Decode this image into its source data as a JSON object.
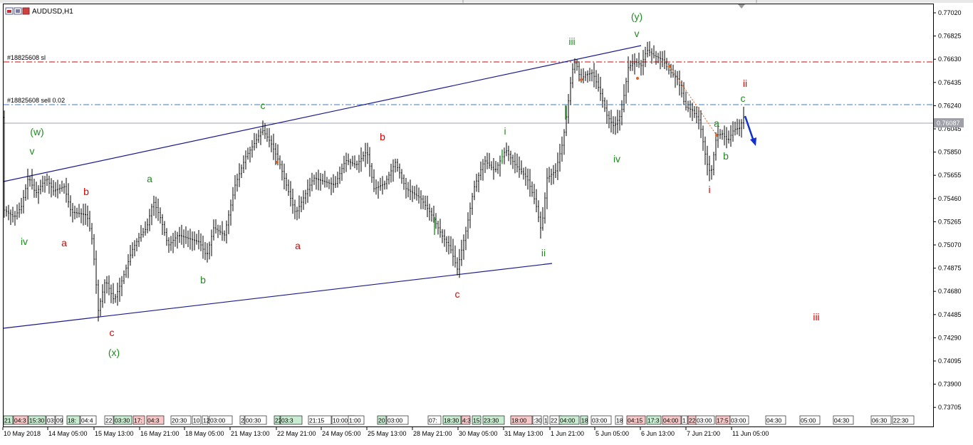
{
  "window": {
    "symbol_title": "AUDUSD,H1"
  },
  "orders": {
    "sl_label": "#18825608 sl",
    "sell_label": "#18825608 sell 0.02"
  },
  "price_axis": {
    "ticks": [
      "0.77020",
      "0.76825",
      "0.76630",
      "0.76435",
      "0.76240",
      "0.76045",
      "0.75850",
      "0.75655",
      "0.75460",
      "0.75265",
      "0.75070",
      "0.74875",
      "0.74680",
      "0.74485",
      "0.74290",
      "0.74095",
      "0.73900",
      "0.73705"
    ],
    "current_price": "0.76087"
  },
  "time_axis": {
    "labels": [
      "10 May 2018",
      "14 May 05:00",
      "15 May 13:00",
      "16 May 21:00",
      "18 May 05:00",
      "21 May 13:00",
      "22 May 21:00",
      "24 May 05:00",
      "25 May 13:00",
      "28 May 21:00",
      "30 May 05:00",
      "31 May 13:00",
      "1 Jun 21:00",
      "5 Jun 05:00",
      "6 Jun 13:00",
      "7 Jun 21:00",
      "11 Jun 05:00"
    ]
  },
  "session_strip": [
    {
      "t": "21",
      "c": "#c8ecd0"
    },
    {
      "t": "04:3",
      "c": "#f8c8c8"
    },
    {
      "t": "15:30",
      "c": "#c8ecd0"
    },
    {
      "t": "03:0",
      "c": "#ffffff"
    },
    {
      "t": "09",
      "c": "#ffffff"
    },
    {
      "t": "18:",
      "c": "#c8ecd0"
    },
    {
      "t": "04:4",
      "c": "#ffffff"
    },
    {
      "t": "22",
      "c": "#ffffff"
    },
    {
      "t": "03:30",
      "c": "#c8ecd0"
    },
    {
      "t": "17:",
      "c": "#f8c8c8"
    },
    {
      "t": "04:3",
      "c": "#f8c8c8"
    },
    {
      "t": "20:30",
      "c": "#ffffff"
    },
    {
      "t": "10",
      "c": "#ffffff"
    },
    {
      "t": "12",
      "c": "#ffffff"
    },
    {
      "t": "03:00",
      "c": "#ffffff"
    },
    {
      "t": "2",
      "c": "#ffffff"
    },
    {
      "t": "00:30",
      "c": "#ffffff"
    },
    {
      "t": "22",
      "c": "#c8ecd0"
    },
    {
      "t": "03:3",
      "c": "#c8ecd0"
    },
    {
      "t": "21:15",
      "c": "#ffffff"
    },
    {
      "t": "10:00",
      "c": "#ffffff"
    },
    {
      "t": "1:00",
      "c": "#ffffff"
    },
    {
      "t": "20",
      "c": "#c8ecd0"
    },
    {
      "t": "03:00",
      "c": "#ffffff"
    },
    {
      "t": "07:",
      "c": "#ffffff"
    },
    {
      "t": "18:30",
      "c": "#c8ecd0"
    },
    {
      "t": "4:3",
      "c": "#f8c8c8"
    },
    {
      "t": "15:",
      "c": "#c8ecd0"
    },
    {
      "t": "23:30",
      "c": "#c8ecd0"
    },
    {
      "t": "18:00",
      "c": "#f8c8c8"
    },
    {
      "t": ":30",
      "c": "#ffffff"
    },
    {
      "t": "1",
      "c": "#ffffff"
    },
    {
      "t": "22",
      "c": "#ffffff"
    },
    {
      "t": "04:00",
      "c": "#c8ecd0"
    },
    {
      "t": "18",
      "c": "#c8ecd0"
    },
    {
      "t": "03:00",
      "c": "#ffffff"
    },
    {
      "t": "18",
      "c": "#ffffff"
    },
    {
      "t": "04:15",
      "c": "#f8c8c8"
    },
    {
      "t": "17:3",
      "c": "#c8ecd0"
    },
    {
      "t": "04:00",
      "c": "#f8c8c8"
    },
    {
      "t": "1",
      "c": "#ffffff"
    },
    {
      "t": "22",
      "c": "#f8c8c8"
    },
    {
      "t": "03:00",
      "c": "#ffffff"
    },
    {
      "t": "17:5",
      "c": "#f8c8c8"
    },
    {
      "t": "03:00",
      "c": "#ffffff"
    },
    {
      "t": "04:30",
      "c": "#ffffff"
    },
    {
      "t": "05:00",
      "c": "#ffffff"
    },
    {
      "t": "04:30",
      "c": "#ffffff"
    },
    {
      "t": "06:30",
      "c": "#ffffff"
    },
    {
      "t": "22:30",
      "c": "#ffffff"
    }
  ],
  "wave_labels": [
    {
      "t": "(w)",
      "c": "green"
    },
    {
      "t": "v",
      "c": "green"
    },
    {
      "t": "iv",
      "c": "green"
    },
    {
      "t": "a",
      "c": "red"
    },
    {
      "t": "b",
      "c": "red"
    },
    {
      "t": "c",
      "c": "red"
    },
    {
      "t": "(x)",
      "c": "green"
    },
    {
      "t": "a",
      "c": "green"
    },
    {
      "t": "b",
      "c": "green"
    },
    {
      "t": "c",
      "c": "green"
    },
    {
      "t": "a",
      "c": "red"
    },
    {
      "t": "b",
      "c": "red"
    },
    {
      "t": "c",
      "c": "red"
    },
    {
      "t": "i",
      "c": "green"
    },
    {
      "t": "ii",
      "c": "green"
    },
    {
      "t": "iii",
      "c": "green"
    },
    {
      "t": "iv",
      "c": "green"
    },
    {
      "t": "(y)",
      "c": "green"
    },
    {
      "t": "v",
      "c": "green"
    },
    {
      "t": "i",
      "c": "red"
    },
    {
      "t": "a",
      "c": "green"
    },
    {
      "t": "b",
      "c": "green"
    },
    {
      "t": "c",
      "c": "green"
    },
    {
      "t": "ii",
      "c": "red"
    },
    {
      "t": "iii",
      "c": "red"
    }
  ],
  "colors": {
    "wave_green": "#1e8c1e",
    "wave_red": "#e00000",
    "sl_line": "#e00000",
    "order_line": "#3c78c8",
    "channel": "#1a1a8c",
    "candle": "#000000"
  }
}
